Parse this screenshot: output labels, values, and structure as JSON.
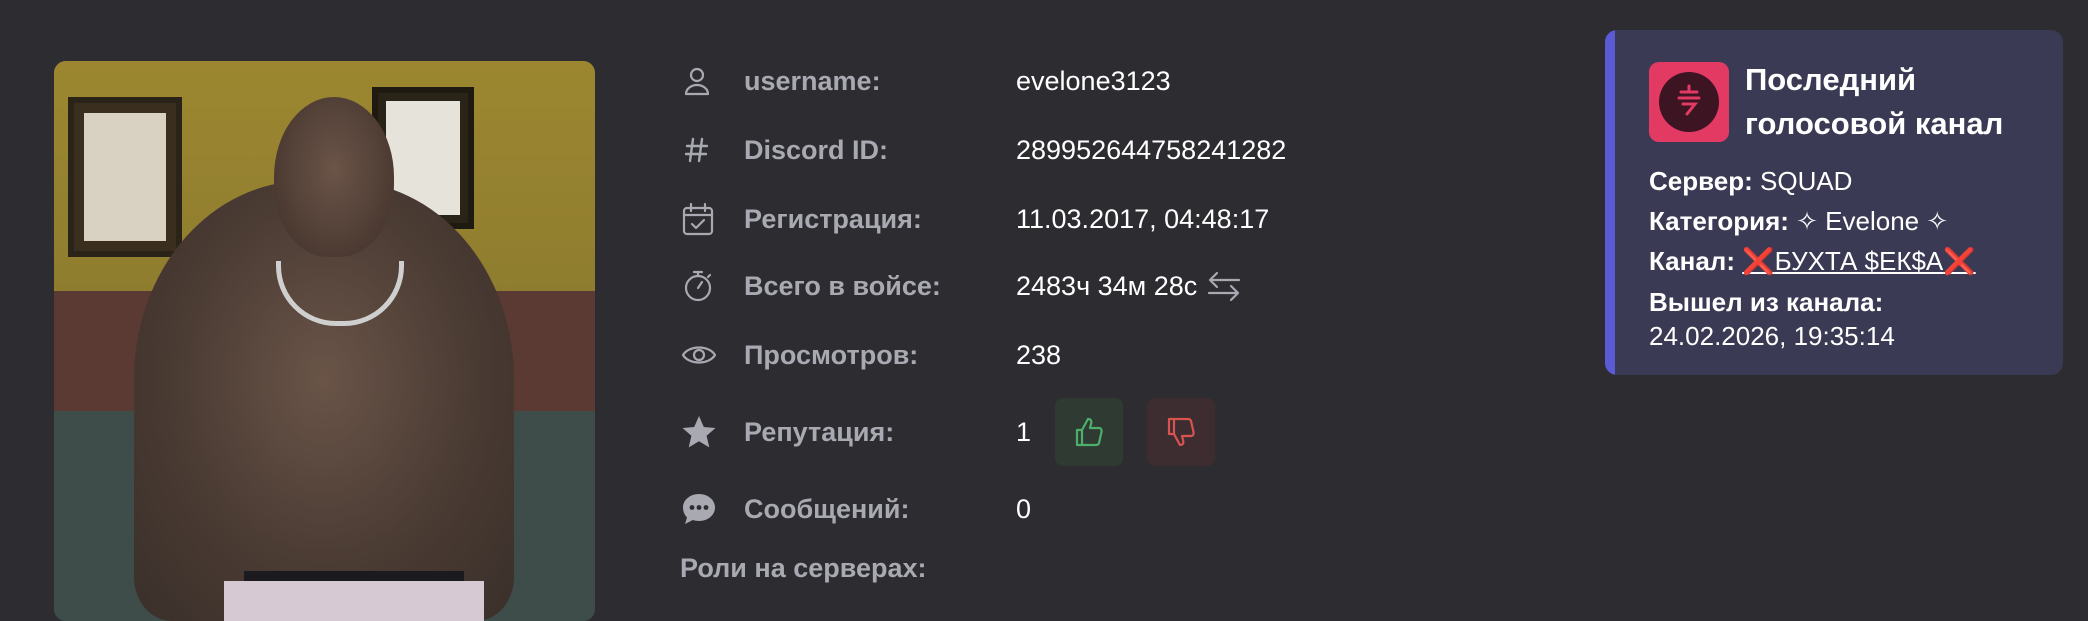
{
  "profile": {
    "avatar_alt": "",
    "fields": [
      {
        "icon": "user-icon",
        "label": "username:",
        "value": "evelone3123"
      },
      {
        "icon": "hash-icon",
        "label": "Discord ID:",
        "value": "289952644758241282"
      },
      {
        "icon": "calendar-icon",
        "label": "Регистрация:",
        "value": "11.03.2017, 04:48:17"
      },
      {
        "icon": "stopwatch-icon",
        "label": "Всего в войсе:",
        "value": "2483ч 34м 28с"
      },
      {
        "icon": "eye-icon",
        "label": "Просмотров:",
        "value": "238"
      },
      {
        "icon": "star-icon",
        "label": "Репутация:",
        "value": "1"
      },
      {
        "icon": "chat-bubble-icon",
        "label": "Сообщений:",
        "value": "0"
      }
    ],
    "roles_title": "Роли на серверах:"
  },
  "voice_card": {
    "title": "Последний голосовой канал",
    "server_label": "Сервер:",
    "server_value": "SQUAD",
    "category_label": "Категория:",
    "category_value": "✧ Evelone ✧",
    "channel_label": "Канал:",
    "channel_mark_left": "❌",
    "channel_value": "БУХТА $ЕК$А",
    "channel_mark_right": "❌",
    "left_label": "Вышел из канала:",
    "left_value": "24.02.2026, 19:35:14"
  },
  "colors": {
    "background": "#2c2c31",
    "card": "#3a3a54",
    "accent": "#5b5bd6",
    "label": "#a9a9b2",
    "like": "#4caf6a",
    "dislike": "#d9534f",
    "logo": "#e33a63"
  }
}
